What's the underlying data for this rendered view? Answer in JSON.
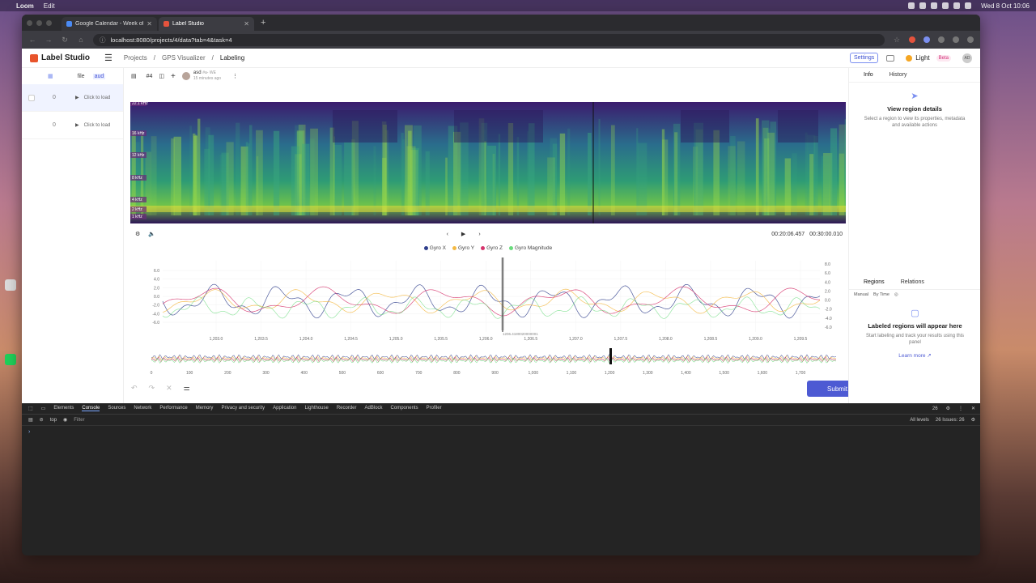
{
  "menubar": {
    "app": "Loom",
    "menu_edit": "Edit",
    "datetime": "Wed 8 Oct 10:06"
  },
  "browser": {
    "tabs": [
      {
        "title": "Google Calendar - Week of 6",
        "active": false
      },
      {
        "title": "Label Studio",
        "active": true
      }
    ],
    "url": "localhost:8080/projects/4/data?tab=4&task=4"
  },
  "app": {
    "logo": "Label Studio",
    "breadcrumbs": [
      "Projects",
      "GPS Visualizer",
      "Labeling"
    ],
    "settings_label": "Settings",
    "theme_label": "Light",
    "beta_label": "Beta",
    "avatar_initials": "AD"
  },
  "left": {
    "tools": {
      "file": "file",
      "audio": "aud",
      "task_id": "#4"
    },
    "tasks": [
      {
        "count": "0",
        "label": "Click to load"
      },
      {
        "count": "0",
        "label": "Click to load"
      }
    ]
  },
  "annotation": {
    "user": "asd",
    "user_tag": "#a- WE",
    "time_ago": "15 minutes ago"
  },
  "spectrogram": {
    "freq_labels": [
      "22.1 kHz",
      "16 kHz",
      "12 kHz",
      "8 kHz",
      "4 kHz",
      "2 kHz",
      "1 kHz"
    ]
  },
  "player": {
    "current_time": "00:20:06.457",
    "total_time": "00:30:00.010"
  },
  "chart_data": {
    "type": "line",
    "series": [
      {
        "name": "Gyro X",
        "color": "#2f3e8c"
      },
      {
        "name": "Gyro Y",
        "color": "#f4b942"
      },
      {
        "name": "Gyro Z",
        "color": "#d6336c"
      },
      {
        "name": "Gyro Magnitude",
        "color": "#69db7c"
      }
    ],
    "x_ticks": [
      "1,203.0",
      "1,203.5",
      "1,204.0",
      "1,204.5",
      "1,205.0",
      "1,205.5",
      "1,206.0",
      "1,206.5",
      "1,207.0",
      "1,207.5",
      "1,208.0",
      "1,208.5",
      "1,209.0",
      "1,209.5"
    ],
    "y_left_ticks": [
      "6.0",
      "4.0",
      "2.0",
      "0.0",
      "-2.0",
      "-4.0",
      "-6.0"
    ],
    "y_right_ticks": [
      "8.0",
      "6.0",
      "4.0",
      "2.0",
      "0.0",
      "-2.0",
      "-4.0",
      "-6.0"
    ],
    "cursor_label": "1206.4180020000001",
    "overview_ticks": [
      "0",
      "100",
      "200",
      "300",
      "400",
      "500",
      "600",
      "700",
      "800",
      "900",
      "1,000",
      "1,100",
      "1,200",
      "1,300",
      "1,400",
      "1,500",
      "1,600",
      "1,700"
    ],
    "ylim": [
      -6,
      6
    ]
  },
  "right": {
    "tabs": [
      "Info",
      "History"
    ],
    "info_title": "View region details",
    "info_sub": "Select a region to view its properties, metadata and available actions",
    "region_tabs": [
      "Regions",
      "Relations"
    ],
    "filters": [
      "Manual",
      "By Time"
    ],
    "regions_title": "Labeled regions will appear here",
    "regions_sub": "Start labeling and track your results using this panel",
    "learn_more": "Learn more"
  },
  "submit_label": "Submit",
  "devtools": {
    "tabs": [
      "Elements",
      "Console",
      "Sources",
      "Network",
      "Performance",
      "Memory",
      "Privacy and security",
      "Application",
      "Lighthouse",
      "Recorder",
      "AdBlock",
      "Components",
      "Profiler"
    ],
    "active_tab": "Console",
    "context": "top",
    "filter_placeholder": "Filter",
    "levels": "All levels",
    "issues": "26 Issues: 26",
    "badge": "26"
  }
}
